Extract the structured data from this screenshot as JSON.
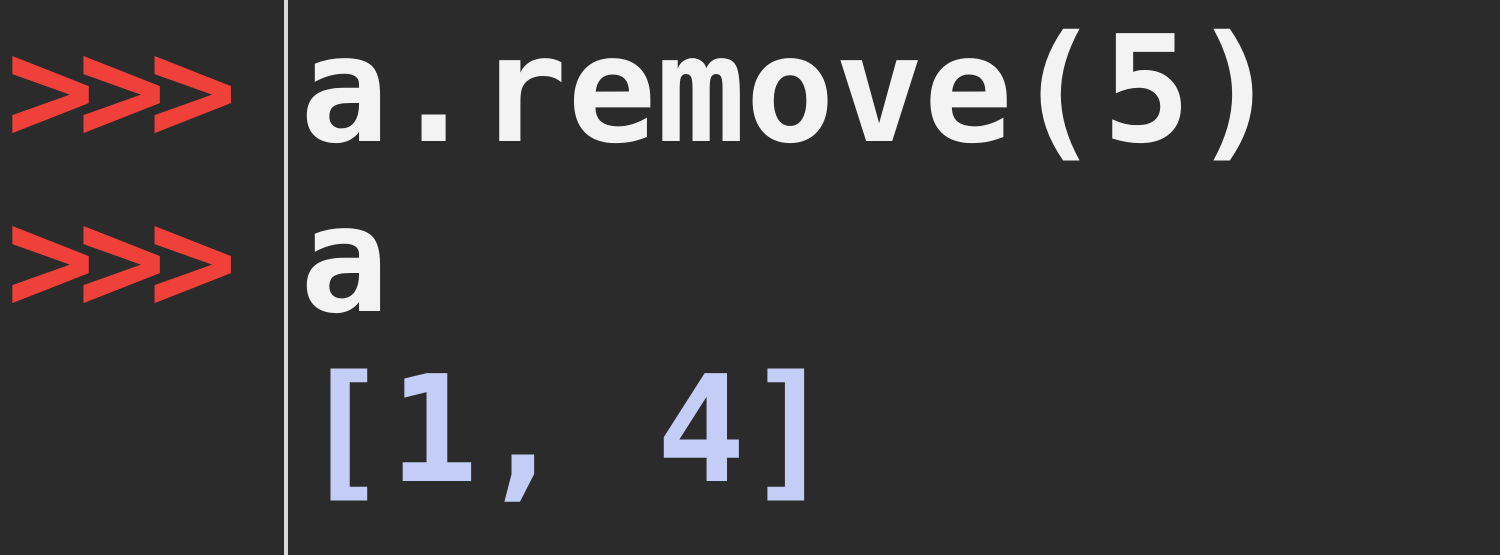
{
  "console": {
    "lines": [
      {
        "prompt": ">>>",
        "code": "a.remove(5)"
      },
      {
        "prompt": ">>>",
        "code": "a"
      },
      {
        "prompt": "",
        "output": "[1, 4]"
      }
    ]
  },
  "colors": {
    "background": "#2b2b2b",
    "prompt": "#f0403a",
    "code": "#f3f3f3",
    "output": "#c3cdf5",
    "divider": "#d8d8d8"
  }
}
